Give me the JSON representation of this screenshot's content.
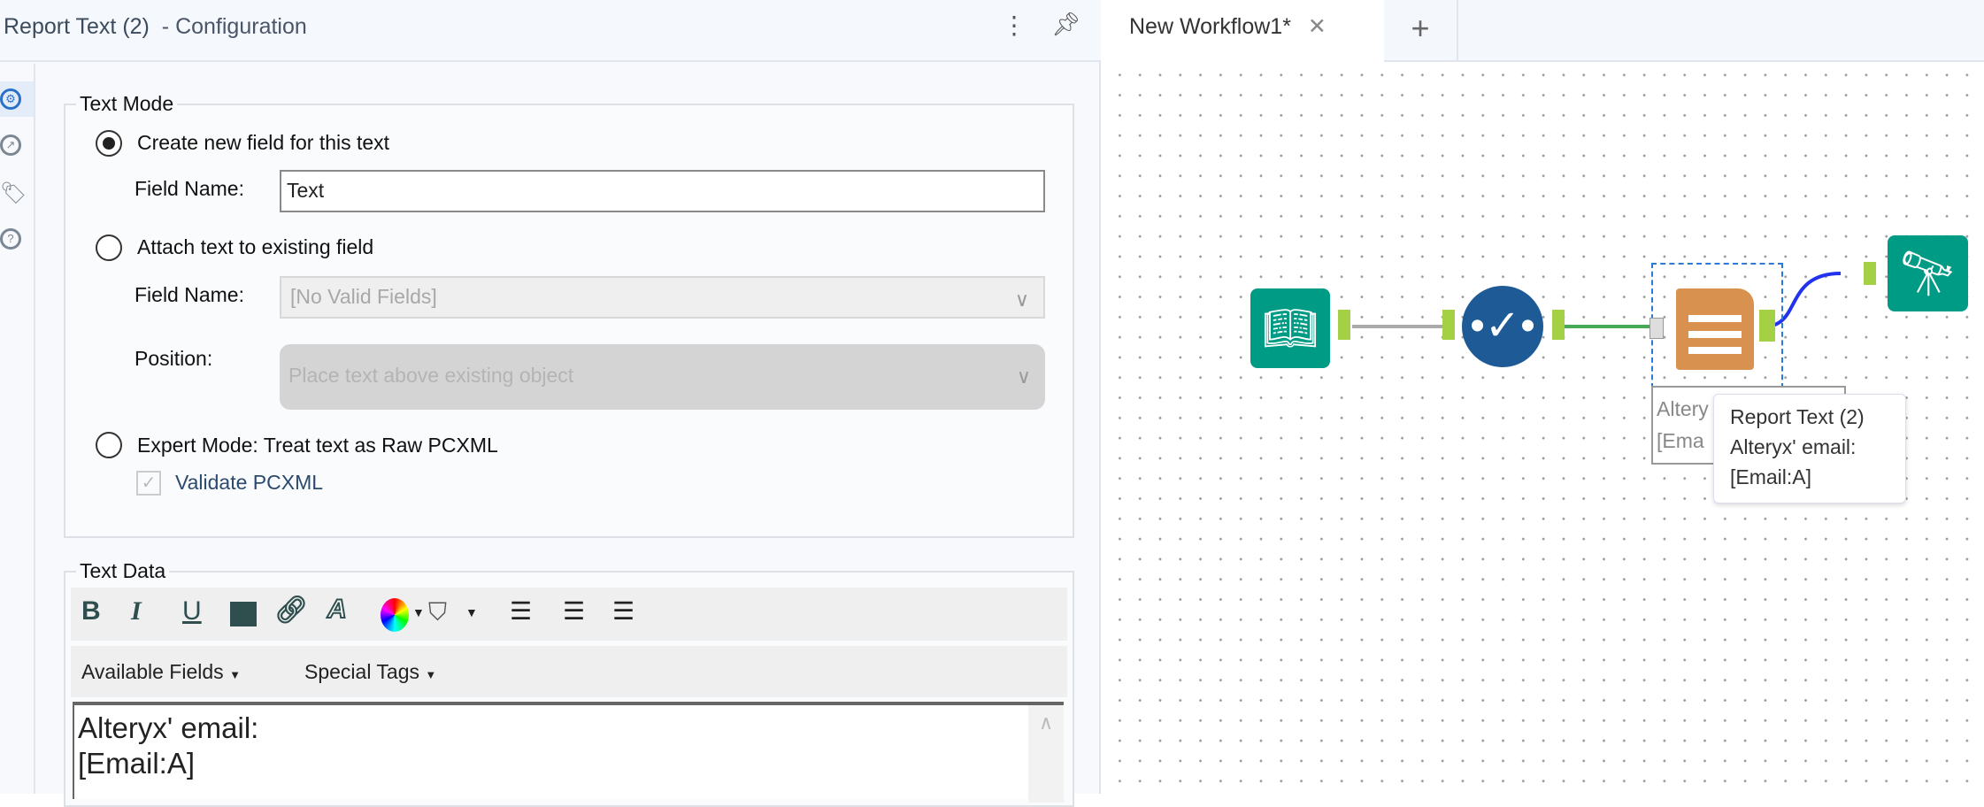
{
  "config": {
    "tool_name": "Report Text (2)",
    "subtitle": "- Configuration",
    "text_mode": {
      "legend": "Text Mode",
      "option_create": "Create new field for this text",
      "field_name_label": "Field Name:",
      "field_name_value": "Text",
      "option_attach": "Attach text to existing field",
      "attach_field_label": "Field Name:",
      "attach_field_value": "[No Valid Fields]",
      "position_label": "Position:",
      "position_value": "Place text above existing object",
      "option_expert": "Expert Mode: Treat text as Raw PCXML",
      "validate_label": "Validate PCXML"
    },
    "text_data": {
      "legend": "Text Data",
      "available_fields": "Available Fields",
      "special_tags": "Special Tags",
      "line1": "Alteryx' email:",
      "line2": "[Email:A]"
    }
  },
  "workflow": {
    "tab_label": "New Workflow1*",
    "node_label_line1": "Altery",
    "node_label_line2": "[Ema",
    "tooltip": {
      "title": "Report Text (2)",
      "line1": "Alteryx' email:",
      "line2": "[Email:A]"
    }
  }
}
